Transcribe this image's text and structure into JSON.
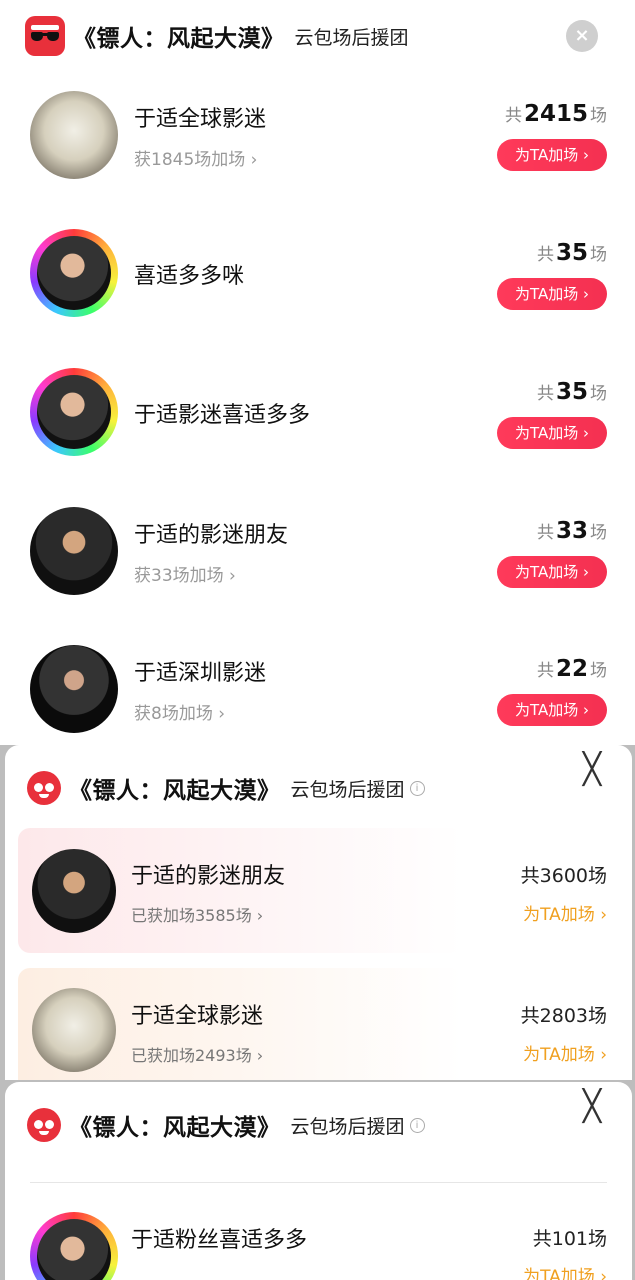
{
  "panel1": {
    "title": "《镖人：风起大漠》",
    "subtitle": "云包场后援团",
    "close_glyph": "×",
    "items": [
      {
        "name": "于适全球影迷",
        "got": "获1845场加场 ›",
        "prefix": "共",
        "count": "2415",
        "unit": "场",
        "button": "为TA加场 ›",
        "avatar": "silver"
      },
      {
        "name": "喜适多多咪",
        "got": "",
        "prefix": "共",
        "count": "35",
        "unit": "场",
        "button": "为TA加场 ›",
        "avatar": "rainbow"
      },
      {
        "name": "于适影迷喜适多多",
        "got": "",
        "prefix": "共",
        "count": "35",
        "unit": "场",
        "button": "为TA加场 ›",
        "avatar": "rainbow"
      },
      {
        "name": "于适的影迷朋友",
        "got": "获33场加场 ›",
        "prefix": "共",
        "count": "33",
        "unit": "场",
        "button": "为TA加场 ›",
        "avatar": "suit"
      },
      {
        "name": "于适深圳影迷",
        "got": "获8场加场 ›",
        "prefix": "共",
        "count": "22",
        "unit": "场",
        "button": "为TA加场 ›",
        "avatar": "dark"
      }
    ]
  },
  "panel2": {
    "title": "《镖人：风起大漠》",
    "subtitle": "云包场后援团",
    "info_glyph": "i",
    "close_glyph": "╳",
    "items": [
      {
        "name": "于适的影迷朋友",
        "got": "已获加场3585场 ›",
        "total": "共3600场",
        "link": "为TA加场 ›"
      },
      {
        "name": "于适全球影迷",
        "got": "已获加场2493场 ›",
        "total": "共2803场",
        "link": "为TA加场 ›"
      }
    ]
  },
  "panel3": {
    "title": "《镖人：风起大漠》",
    "subtitle": "云包场后援团",
    "info_glyph": "i",
    "close_glyph": "╳",
    "items": [
      {
        "name": "于适粉丝喜适多多",
        "total": "共101场",
        "link": "为TA加场 ›"
      }
    ]
  },
  "colors": {
    "brand_red": "#e8303b",
    "button_red": "#f43051",
    "link_orange": "#f0a020"
  },
  "icons": {
    "app_logo_top": "sunglasses-app-icon",
    "app_logo_cat": "red-cat-app-icon"
  }
}
